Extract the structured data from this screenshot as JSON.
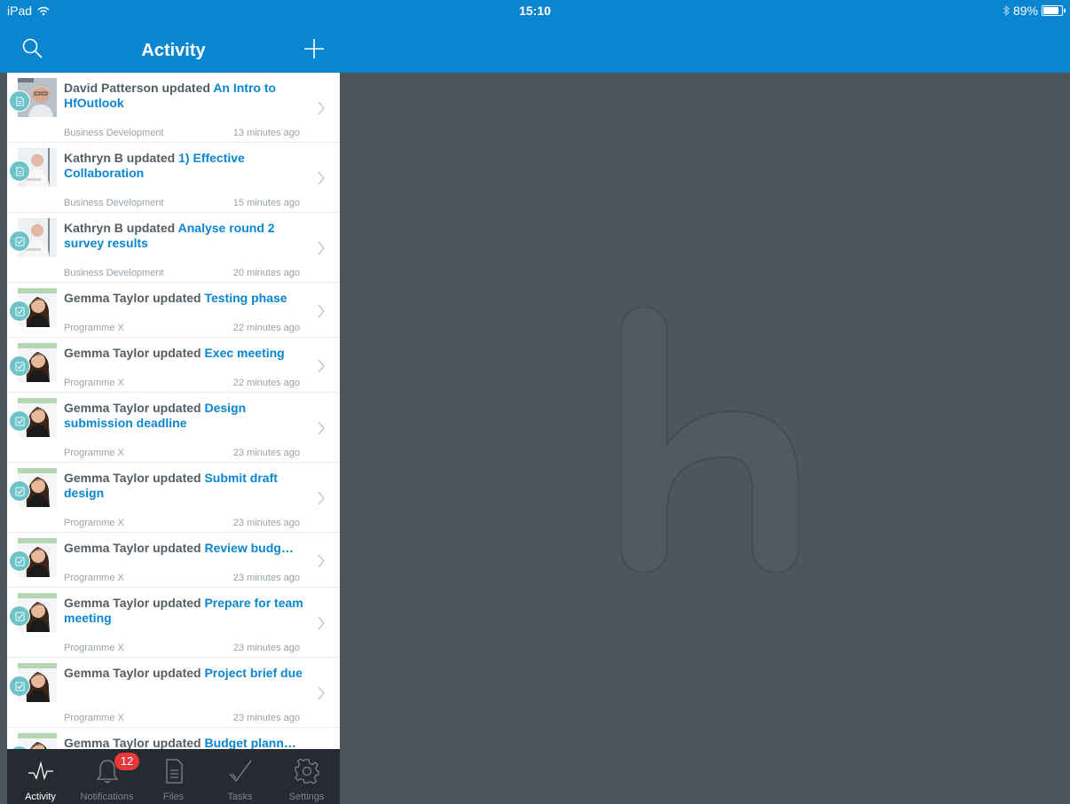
{
  "status_bar": {
    "device": "iPad",
    "time": "15:10",
    "battery": "89%"
  },
  "header": {
    "title": "Activity"
  },
  "activity": [
    {
      "actor": "David Patterson",
      "verb": "updated",
      "item": "An Intro to HfOutlook",
      "group": "Business Development",
      "time": "13 minutes ago",
      "type": "document",
      "avatar": "man-avatar",
      "layout": "tall"
    },
    {
      "actor": "Kathryn B",
      "verb": "updated",
      "item": "1) Effective Collaboration",
      "group": "Business Development",
      "time": "15 minutes ago",
      "type": "document",
      "avatar": "woman-avatar",
      "layout": "tall"
    },
    {
      "actor": "Kathryn B",
      "verb": "updated",
      "item": "Analyse round 2 survey results",
      "group": "Business Development",
      "time": "20 minutes ago",
      "type": "task",
      "avatar": "woman-avatar",
      "layout": "tall"
    },
    {
      "actor": "Gemma Taylor",
      "verb": "updated",
      "item": "Testing phase",
      "group": "Programme X",
      "time": "22 minutes ago",
      "type": "task",
      "avatar": "gemma-avatar",
      "layout": "short"
    },
    {
      "actor": "Gemma Taylor",
      "verb": "updated",
      "item": "Exec meeting",
      "group": "Programme X",
      "time": "22 minutes ago",
      "type": "task",
      "avatar": "gemma-avatar",
      "layout": "short"
    },
    {
      "actor": "Gemma Taylor",
      "verb": "updated",
      "item": "Design submission deadline",
      "group": "Programme X",
      "time": "23 minutes ago",
      "type": "task",
      "avatar": "gemma-avatar",
      "layout": "tall"
    },
    {
      "actor": "Gemma Taylor",
      "verb": "updated",
      "item": "Submit draft design",
      "group": "Programme X",
      "time": "23 minutes ago",
      "type": "task",
      "avatar": "gemma-avatar",
      "layout": "tall"
    },
    {
      "actor": "Gemma Taylor",
      "verb": "updated",
      "item": "Review budg…",
      "group": "Programme X",
      "time": "23 minutes ago",
      "type": "task",
      "avatar": "gemma-avatar",
      "layout": "short"
    },
    {
      "actor": "Gemma Taylor",
      "verb": "updated",
      "item": "Prepare for team meeting",
      "group": "Programme X",
      "time": "23 minutes ago",
      "type": "task",
      "avatar": "gemma-avatar",
      "layout": "tall"
    },
    {
      "actor": "Gemma Taylor",
      "verb": "updated",
      "item": "Project brief due",
      "group": "Programme X",
      "time": "23 minutes ago",
      "type": "task",
      "avatar": "gemma-avatar",
      "layout": "tall"
    },
    {
      "actor": "Gemma Taylor",
      "verb": "updated",
      "item": "Budget plann…",
      "group": "",
      "time": "",
      "type": "task",
      "avatar": "gemma-avatar",
      "layout": "cut"
    }
  ],
  "tabs": [
    {
      "label": "Activity",
      "icon": "activity-icon",
      "active": true
    },
    {
      "label": "Notifications",
      "icon": "bell-icon",
      "count": "12"
    },
    {
      "label": "Files",
      "icon": "file-icon"
    },
    {
      "label": "Tasks",
      "icon": "checkmark-icon"
    },
    {
      "label": "Settings",
      "icon": "gear-icon"
    }
  ],
  "colors": {
    "brand": "#0a86d0",
    "link": "#0a86d0",
    "badge": "#6ec3c9",
    "tabbar": "#262b31",
    "detail_bg": "#4c565f",
    "alert": "#e8383c"
  }
}
